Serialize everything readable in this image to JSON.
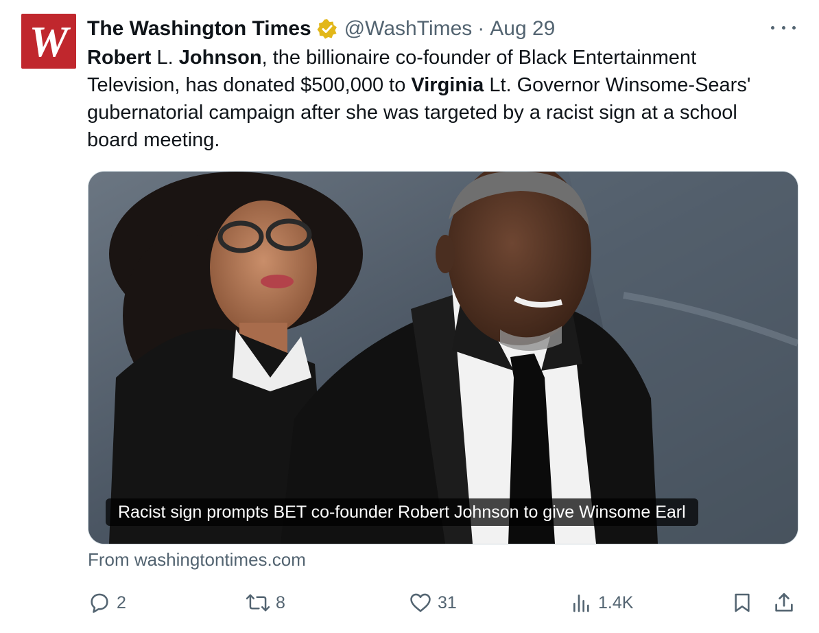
{
  "account": {
    "name": "The Washington Times",
    "handle": "@WashTimes",
    "separator": "·",
    "date": "Aug 29",
    "avatar_letter": "W",
    "verified_icon": "verified-gold-badge-icon"
  },
  "tweet": {
    "segments": [
      {
        "text": "Robert",
        "bold": true
      },
      {
        "text": " L. ",
        "bold": false
      },
      {
        "text": "Johnson",
        "bold": true
      },
      {
        "text": ", the billionaire co-founder of Black Entertainment Television, has donated $500,000 to ",
        "bold": false
      },
      {
        "text": "Virginia",
        "bold": true
      },
      {
        "text": " Lt. Governor Winsome-Sears' gubernatorial campaign after she was targeted by a racist sign at a school board meeting.",
        "bold": false
      }
    ]
  },
  "card": {
    "caption": "Racist sign prompts BET co-founder Robert Johnson to give Winsome Earl",
    "source": "From washingtontimes.com"
  },
  "actions": {
    "replies": "2",
    "reposts": "8",
    "likes": "31",
    "views": "1.4K"
  },
  "colors": {
    "text": "#0f1419",
    "secondary": "#536471",
    "avatar_bg": "#c0272d",
    "verified": "#e2b719"
  }
}
